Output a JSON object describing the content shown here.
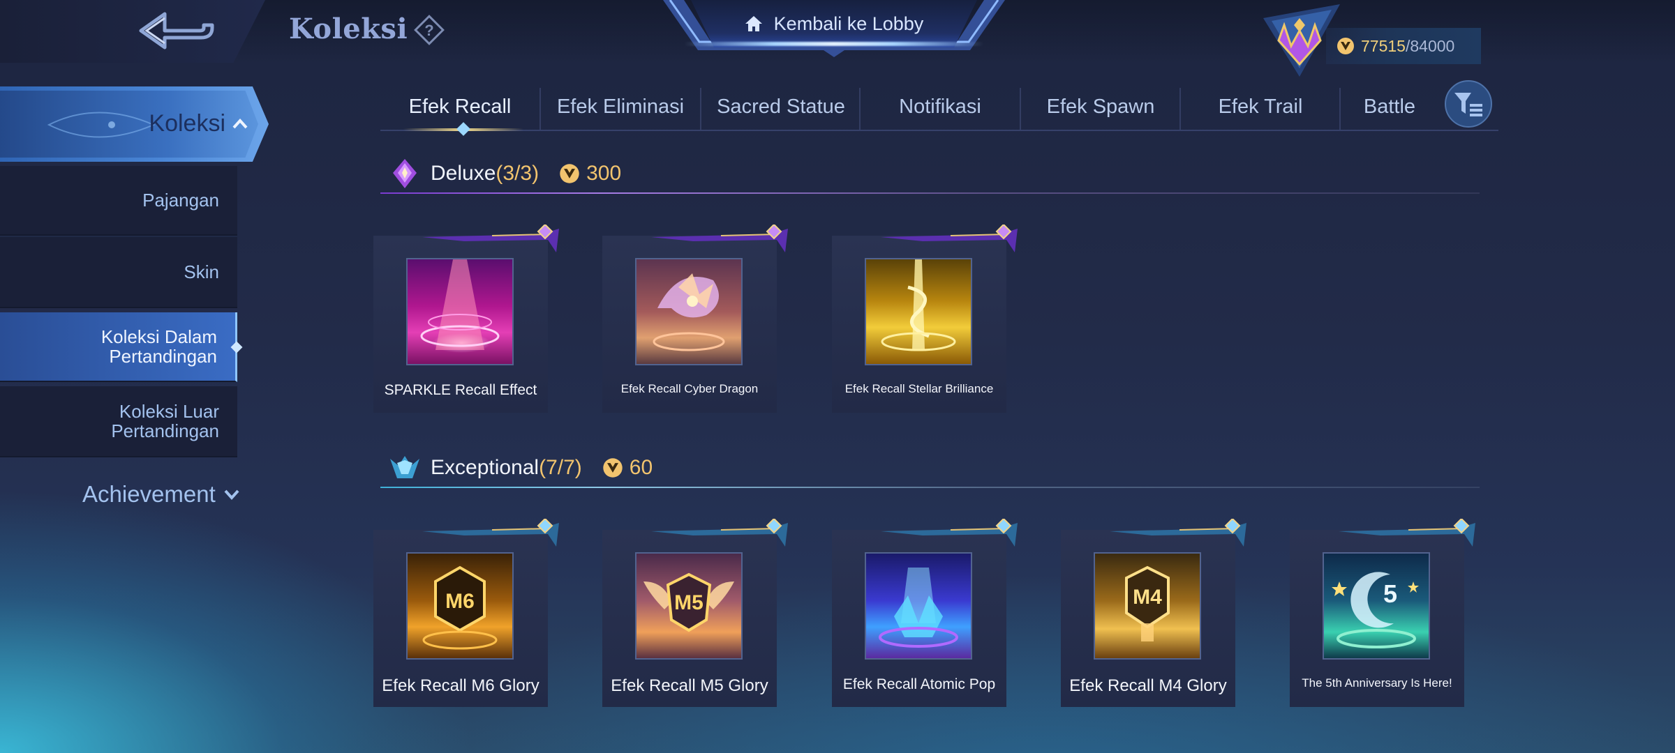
{
  "header": {
    "title": "Koleksi",
    "lobby_label": "Kembali ke Lobby",
    "currency_current": "77515",
    "currency_max": "/84000"
  },
  "sidebar": {
    "head_label": "Koleksi",
    "items": [
      {
        "label": "Pajangan"
      },
      {
        "label": "Skin"
      },
      {
        "label": "Koleksi Dalam Pertandingan"
      },
      {
        "label": "Koleksi Luar Pertandingan"
      }
    ],
    "achievement_label": "Achievement"
  },
  "tabs": [
    {
      "label": "Efek Recall"
    },
    {
      "label": "Efek Eliminasi"
    },
    {
      "label": "Sacred Statue"
    },
    {
      "label": "Notifikasi"
    },
    {
      "label": "Efek Spawn"
    },
    {
      "label": "Efek Trail"
    },
    {
      "label": "Battle"
    }
  ],
  "sections": [
    {
      "name": "Deluxe",
      "count": "(3/3)",
      "cost": "300",
      "items": [
        {
          "label": "SPARKLE Recall Effect"
        },
        {
          "label": "Efek Recall Cyber Dragon"
        },
        {
          "label": "Efek Recall Stellar Brilliance"
        }
      ]
    },
    {
      "name": "Exceptional",
      "count": "(7/7)",
      "cost": "60",
      "items": [
        {
          "label": "Efek Recall M6 Glory",
          "badge": "M6"
        },
        {
          "label": "Efek Recall M5 Glory",
          "badge": "M5"
        },
        {
          "label": "Efek Recall Atomic Pop"
        },
        {
          "label": "Efek Recall M4 Glory",
          "badge": "M4"
        },
        {
          "label": "The 5th Anniversary Is Here!",
          "badge": "5"
        }
      ]
    }
  ],
  "colors": {
    "accent_gold": "#f2c46e",
    "sidebar_active": "#3a6cc4",
    "deluxe_purple": "#8a3cd8",
    "exceptional_teal": "#3fb0d8"
  }
}
